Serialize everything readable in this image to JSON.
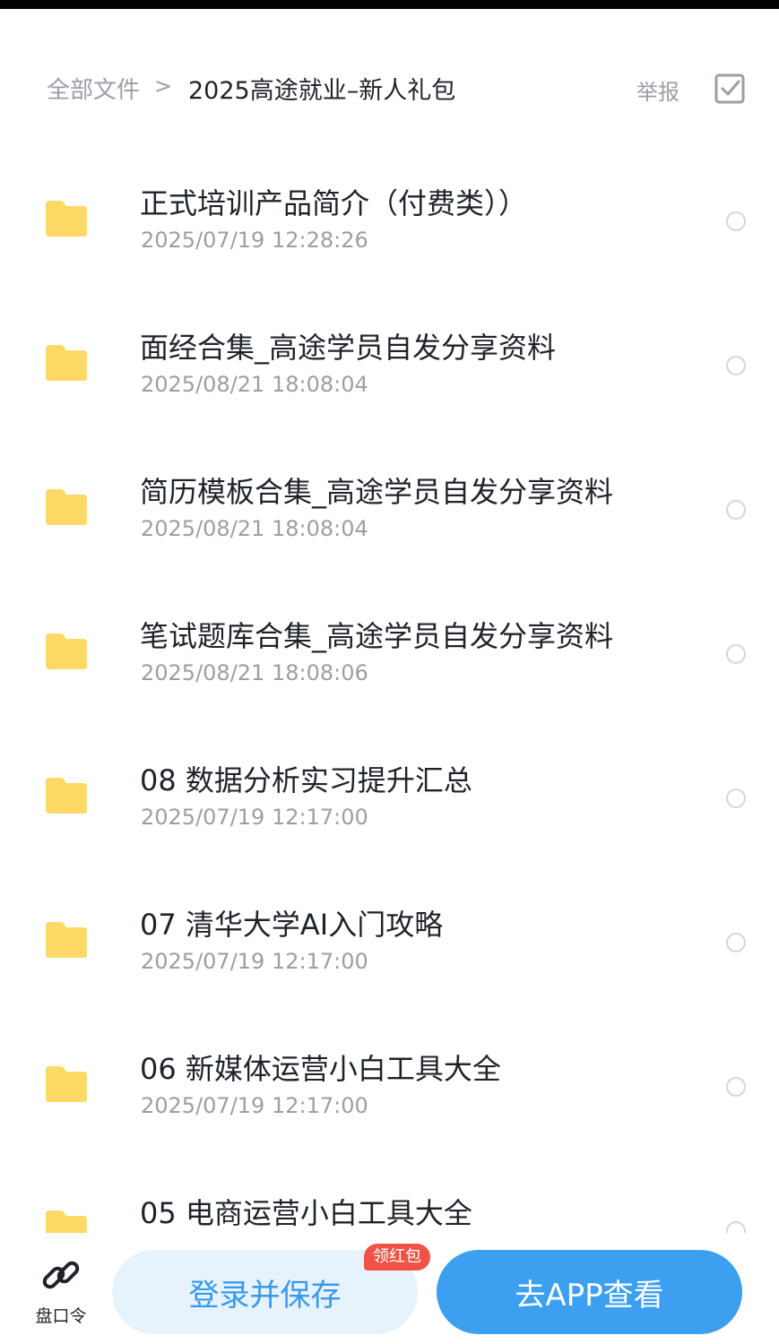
{
  "header": {
    "breadcrumb_root": "全部文件",
    "breadcrumb_separator": ">",
    "breadcrumb_current": "2025高途就业–新人礼包",
    "report_label": "举报",
    "select_icon": "checkbox-icon"
  },
  "files": [
    {
      "name": "正式培训产品简介（付费类））",
      "date": "2025/07/19 12:28:26"
    },
    {
      "name": "面经合集_高途学员自发分享资料",
      "date": "2025/08/21 18:08:04"
    },
    {
      "name": "简历模板合集_高途学员自发分享资料",
      "date": "2025/08/21 18:08:04"
    },
    {
      "name": "笔试题库合集_高途学员自发分享资料",
      "date": "2025/08/21 18:08:06"
    },
    {
      "name": "08 数据分析实习提升汇总",
      "date": "2025/07/19 12:17:00"
    },
    {
      "name": "07 清华大学AI入门攻略",
      "date": "2025/07/19 12:17:00"
    },
    {
      "name": "06 新媒体运营小白工具大全",
      "date": "2025/07/19 12:17:00"
    },
    {
      "name": "05 电商运营小白工具大全",
      "date": ""
    }
  ],
  "bottom": {
    "link_label": "盘口令",
    "save_label": "登录并保存",
    "redpack_badge": "领红包",
    "app_label": "去APP查看"
  },
  "colors": {
    "folder": "#FFD966",
    "primary_blue": "#3D9FF0",
    "light_blue_bg": "#E6F3FD",
    "badge_red": "#F05346"
  }
}
